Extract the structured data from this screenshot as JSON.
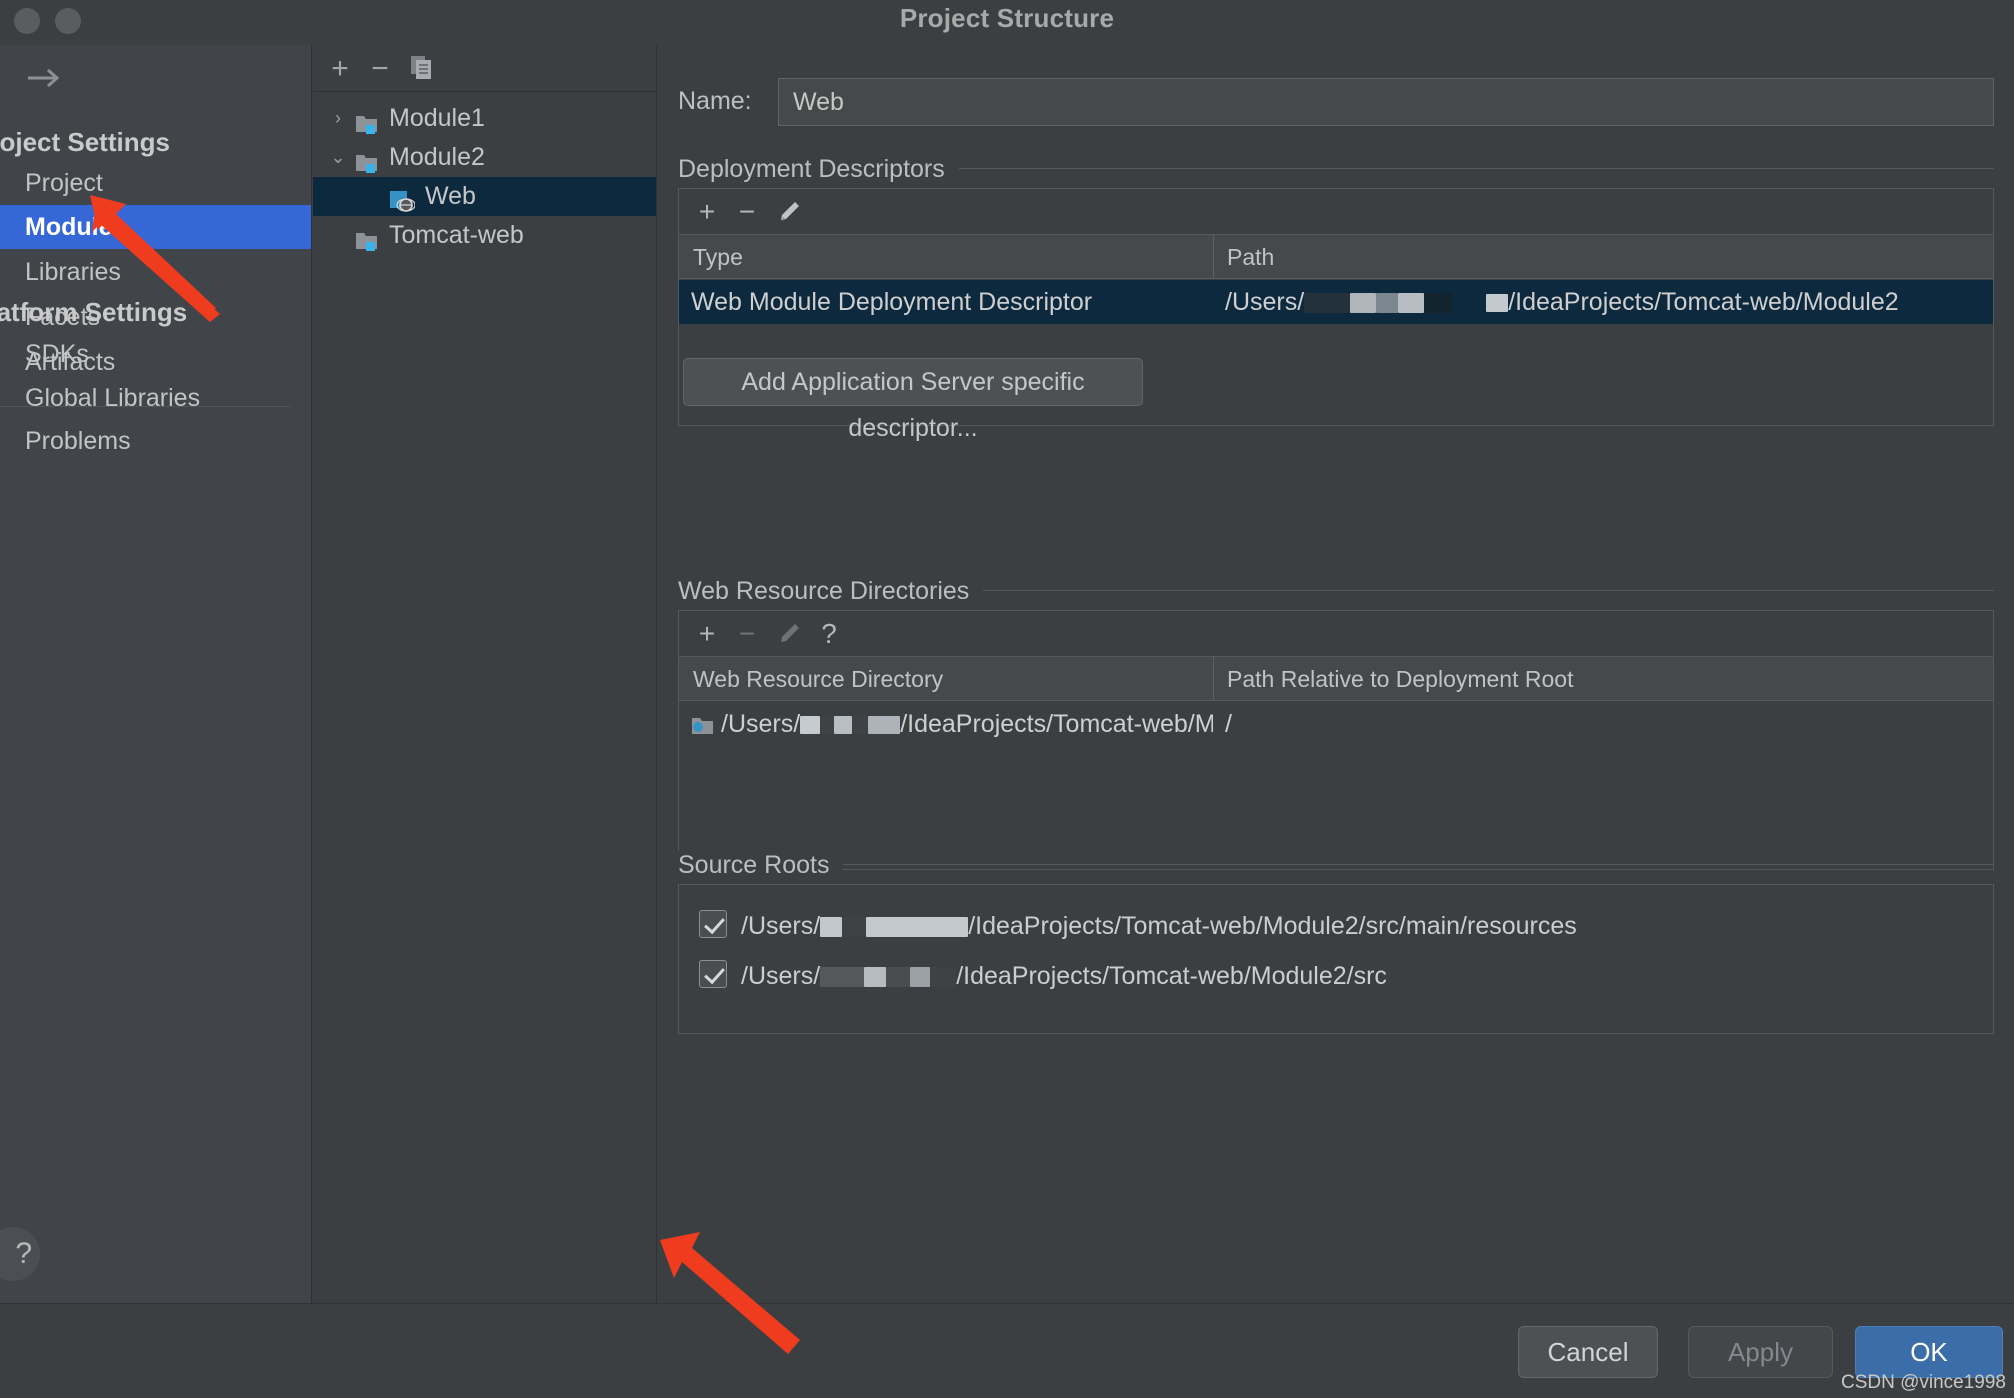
{
  "window": {
    "title": "Project Structure",
    "traffic_lights": [
      "close-button",
      "minimize-button"
    ]
  },
  "sidebar": {
    "back_forward_icon": "arrow-right-icon",
    "sections": [
      {
        "label": "Project Settings",
        "items": [
          {
            "label": "Project",
            "selected": false
          },
          {
            "label": "Modules",
            "selected": true
          },
          {
            "label": "Libraries",
            "selected": false
          },
          {
            "label": "Facets",
            "selected": false
          },
          {
            "label": "Artifacts",
            "selected": false
          }
        ]
      },
      {
        "label": "Platform Settings",
        "items": [
          {
            "label": "SDKs",
            "selected": false
          },
          {
            "label": "Global Libraries",
            "selected": false
          }
        ]
      }
    ],
    "problems_label": "Problems",
    "help_label": "?"
  },
  "tree": {
    "toolbar": [
      {
        "icon": "plus-icon",
        "label": "+"
      },
      {
        "icon": "minus-icon",
        "label": "−"
      },
      {
        "icon": "copy-icon",
        "label": ""
      }
    ],
    "items": [
      {
        "label": "Module1",
        "twisty": "›",
        "indent": 0,
        "icon": "module-folder-icon",
        "selected": false
      },
      {
        "label": "Module2",
        "twisty": "⌄",
        "indent": 0,
        "icon": "module-folder-icon",
        "selected": false
      },
      {
        "label": "Web",
        "twisty": "",
        "indent": 1,
        "icon": "web-facet-icon",
        "selected": true
      },
      {
        "label": "Tomcat-web",
        "twisty": "",
        "indent": 0,
        "icon": "module-folder-icon",
        "selected": false
      }
    ]
  },
  "main": {
    "name_label": "Name:",
    "name_value": "Web",
    "deployment": {
      "group_title": "Deployment Descriptors",
      "toolbar": [
        {
          "icon": "plus-icon",
          "label": "+",
          "enabled": true
        },
        {
          "icon": "minus-icon",
          "label": "−",
          "enabled": true
        },
        {
          "icon": "pencil-icon",
          "label": "",
          "enabled": true
        }
      ],
      "columns": [
        "Type",
        "Path"
      ],
      "rows": [
        {
          "type": "Web Module Deployment Descriptor",
          "path_prefix": "/Users/",
          "path_suffix": "/IdeaProjects/Tomcat-web/Module2",
          "selected": true
        }
      ],
      "add_button_label": "Add Application Server specific descriptor..."
    },
    "web_resources": {
      "group_title": "Web Resource Directories",
      "toolbar": [
        {
          "icon": "plus-icon",
          "label": "+",
          "enabled": true
        },
        {
          "icon": "minus-icon",
          "label": "−",
          "enabled": false
        },
        {
          "icon": "pencil-icon",
          "label": "",
          "enabled": false
        },
        {
          "icon": "help-icon",
          "label": "?",
          "enabled": true
        }
      ],
      "columns": [
        "Web Resource Directory",
        "Path Relative to Deployment Root"
      ],
      "rows": [
        {
          "directory_prefix": "/Users/",
          "directory_suffix": "/IdeaProjects/Tomcat-web/Mo...",
          "relative_path": "/",
          "icon": "folder-icon"
        }
      ]
    },
    "source_roots": {
      "group_title": "Source Roots",
      "rows": [
        {
          "checked": true,
          "path_prefix": "/Users/",
          "path_suffix": "/IdeaProjects/Tomcat-web/Module2/src/main/resources"
        },
        {
          "checked": true,
          "path_prefix": "/Users/",
          "path_suffix": "/IdeaProjects/Tomcat-web/Module2/src"
        }
      ]
    }
  },
  "footer": {
    "cancel_label": "Cancel",
    "apply_label": "Apply",
    "ok_label": "OK",
    "watermark": "CSDN @vince1998"
  },
  "annotations": {
    "arrow_color": "#f03c1e",
    "arrows": [
      {
        "name": "arrow-pointing-to-modules"
      },
      {
        "name": "arrow-pointing-to-source-root-checkbox"
      }
    ]
  },
  "colors": {
    "window_bg": "#3c3f41",
    "sidebar_bg": "#41454a",
    "selection_blue": "#3567d6",
    "row_selection": "#0d293e",
    "ok_button": "#3b6ea8",
    "accent_cyan": "#3592c4",
    "arrow_red": "#f03c1e"
  }
}
